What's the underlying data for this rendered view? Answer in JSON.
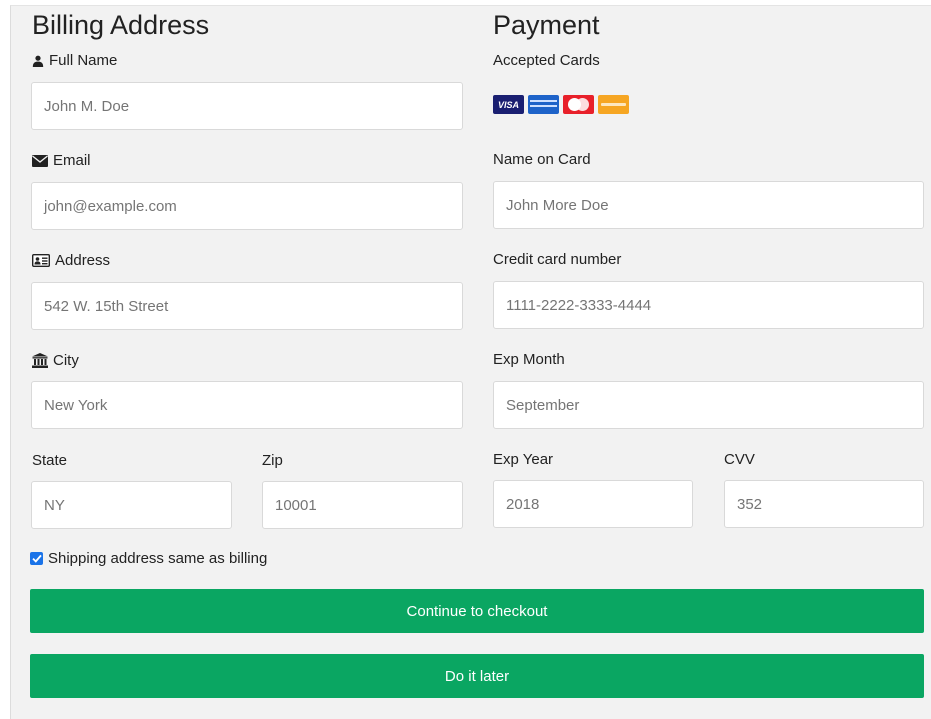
{
  "billing": {
    "title": "Billing Address",
    "full_name_label": "Full Name",
    "full_name_placeholder": "John M. Doe",
    "email_label": "Email",
    "email_placeholder": "john@example.com",
    "address_label": "Address",
    "address_placeholder": "542 W. 15th Street",
    "city_label": "City",
    "city_placeholder": "New York",
    "state_label": "State",
    "state_placeholder": "NY",
    "zip_label": "Zip",
    "zip_placeholder": "10001"
  },
  "payment": {
    "title": "Payment",
    "accepted_cards_label": "Accepted Cards",
    "cards": [
      "visa",
      "amex",
      "mastercard",
      "discover"
    ],
    "visa_text": "VISA",
    "name_on_card_label": "Name on Card",
    "name_on_card_placeholder": "John More Doe",
    "card_number_label": "Credit card number",
    "card_number_placeholder": "1111-2222-3333-4444",
    "exp_month_label": "Exp Month",
    "exp_month_placeholder": "September",
    "exp_year_label": "Exp Year",
    "exp_year_placeholder": "2018",
    "cvv_label": "CVV",
    "cvv_placeholder": "352"
  },
  "shipping": {
    "label": "Shipping address same as billing",
    "checked": true
  },
  "buttons": {
    "continue_label": "Continue to checkout",
    "later_label": "Do it later"
  },
  "colors": {
    "button": "#0aa662",
    "panel": "#f2f2f2",
    "checkbox": "#1a73e8"
  }
}
